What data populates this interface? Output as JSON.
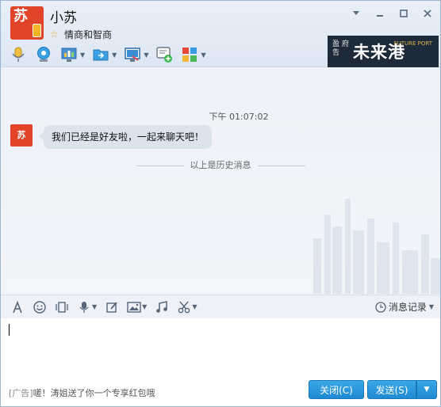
{
  "contact": {
    "name": "小苏",
    "signature": "情商和智商",
    "avatar_text": "苏"
  },
  "window_controls": [
    "chevron-down-icon",
    "minimize-icon",
    "maximize-icon",
    "close-icon"
  ],
  "toolbar": {
    "icons": [
      "microphone-icon",
      "video-camera-icon",
      "screen-share-icon",
      "file-transfer-icon",
      "remote-desktop-icon",
      "add-chat-icon",
      "apps-icon"
    ]
  },
  "ad_banner": {
    "small_text": "盈 府告",
    "main_text": "未来港",
    "sub_text": "FUTURE PORT"
  },
  "chat": {
    "timestamp": "下午 01:07:02",
    "message": "我们已经是好友啦，一起来聊天吧！",
    "history_divider": "以上是历史消息"
  },
  "input_toolbar": {
    "icons": [
      "font-icon",
      "emoji-icon",
      "shake-icon",
      "voice-icon",
      "edit-icon",
      "image-icon",
      "music-icon",
      "scissors-icon"
    ],
    "history_label": "消息记录"
  },
  "footer": {
    "ad_tag": "[广告]",
    "ad_text": "嗟！涛姐送了你一个专享红包哦",
    "close_label": "关闭(C)",
    "send_label": "发送(S)"
  },
  "colors": {
    "accent_blue": "#2696dd",
    "avatar_red": "#e2442a",
    "banner_dark": "#1d2a3a"
  }
}
